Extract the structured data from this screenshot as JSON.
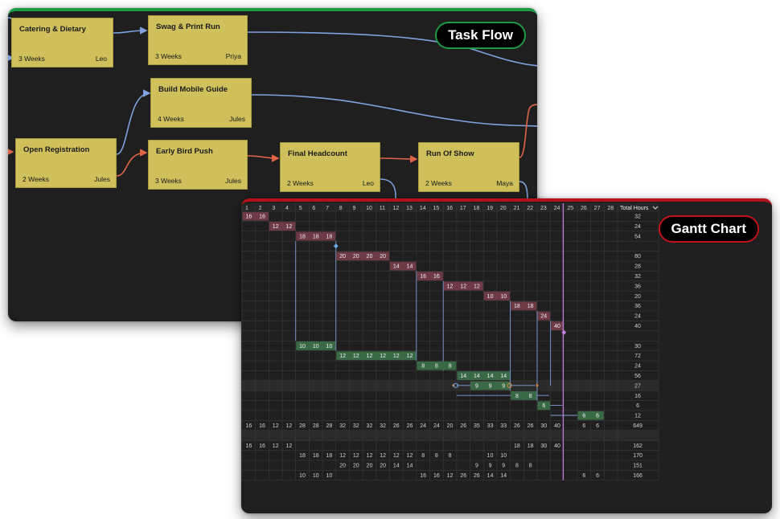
{
  "task_flow": {
    "title": "Task Flow",
    "tasks": [
      {
        "name": "Catering & Dietary",
        "duration": "3 Weeks",
        "owner": "Leo"
      },
      {
        "name": "Swag & Print Run",
        "duration": "3 Weeks",
        "owner": "Priya"
      },
      {
        "name": "Build Mobile Guide",
        "duration": "4 Weeks",
        "owner": "Jules"
      },
      {
        "name": "Open Registration",
        "duration": "2 Weeks",
        "owner": "Jules"
      },
      {
        "name": "Early Bird Push",
        "duration": "3 Weeks",
        "owner": "Jules"
      },
      {
        "name": "Final Headcount",
        "duration": "2 Weeks",
        "owner": "Leo"
      },
      {
        "name": "Run Of Show",
        "duration": "2 Weeks",
        "owner": "Maya"
      }
    ]
  },
  "gantt": {
    "title": "Gantt Chart",
    "total_label": "Total Hours",
    "columns": [
      "1",
      "2",
      "3",
      "4",
      "5",
      "6",
      "7",
      "8",
      "9",
      "10",
      "11",
      "12",
      "13",
      "14",
      "15",
      "16",
      "17",
      "18",
      "19",
      "20",
      "21",
      "22",
      "23",
      "24",
      "25",
      "26",
      "27",
      "28"
    ],
    "colors": {
      "red_bar": "#6e3a45",
      "green_bar": "#3a6a45",
      "today_line": "#c57ee0",
      "link_line": "#7f9fd8",
      "handle": "#e0883a"
    },
    "today_column": "24",
    "rows": [
      {
        "start": 1,
        "values": [
          "16",
          "16"
        ],
        "color": "red",
        "total": "32"
      },
      {
        "start": 3,
        "values": [
          "12",
          "12"
        ],
        "color": "red",
        "total": "24"
      },
      {
        "start": 5,
        "values": [
          "18",
          "18",
          "18"
        ],
        "color": "red",
        "total": "54"
      },
      {
        "start": 0,
        "values": [],
        "color": "",
        "total": ""
      },
      {
        "start": 8,
        "values": [
          "20",
          "20",
          "20",
          "20"
        ],
        "color": "red",
        "total": "80"
      },
      {
        "start": 12,
        "values": [
          "14",
          "14"
        ],
        "color": "red",
        "total": "28"
      },
      {
        "start": 14,
        "values": [
          "16",
          "16"
        ],
        "color": "red",
        "total": "32"
      },
      {
        "start": 16,
        "values": [
          "12",
          "12",
          "12"
        ],
        "color": "red",
        "total": "36"
      },
      {
        "start": 19,
        "values": [
          "10",
          "10"
        ],
        "color": "red",
        "total": "20"
      },
      {
        "start": 21,
        "values": [
          "18",
          "18"
        ],
        "color": "red",
        "total": "36"
      },
      {
        "start": 23,
        "values": [
          "24"
        ],
        "color": "red",
        "total": "24"
      },
      {
        "start": 24,
        "values": [
          "40"
        ],
        "color": "red",
        "total": "40"
      },
      {
        "start": 0,
        "values": [],
        "color": "",
        "total": ""
      },
      {
        "start": 5,
        "values": [
          "10",
          "10",
          "10"
        ],
        "color": "green",
        "total": "30"
      },
      {
        "start": 8,
        "values": [
          "12",
          "12",
          "12",
          "12",
          "12",
          "12"
        ],
        "color": "green",
        "total": "72"
      },
      {
        "start": 14,
        "values": [
          "8",
          "8",
          "8"
        ],
        "color": "green",
        "total": "24"
      },
      {
        "start": 17,
        "values": [
          "14",
          "14",
          "14",
          "14"
        ],
        "color": "green",
        "total": "56"
      },
      {
        "start": 18,
        "values": [
          "9",
          "9",
          "9"
        ],
        "color": "green",
        "total": "27"
      },
      {
        "start": 21,
        "values": [
          "8",
          "8"
        ],
        "color": "green",
        "total": "16"
      },
      {
        "start": 23,
        "values": [
          "6"
        ],
        "color": "green",
        "total": "6"
      },
      {
        "start": 26,
        "values": [
          "6",
          "6"
        ],
        "color": "green",
        "total": "12"
      }
    ],
    "summary_total": [
      "16",
      "16",
      "12",
      "12",
      "28",
      "28",
      "28",
      "32",
      "32",
      "32",
      "32",
      "26",
      "26",
      "24",
      "24",
      "20",
      "26",
      "35",
      "33",
      "33",
      "26",
      "26",
      "30",
      "40",
      "",
      "6",
      "6",
      ""
    ],
    "summary_total_hours": "649",
    "resources": [
      {
        "values": [
          "16",
          "16",
          "12",
          "12",
          "",
          "",
          "",
          "",
          "",
          "",
          "",
          "",
          "",
          "",
          "",
          "",
          "",
          "",
          "",
          "",
          "18",
          "18",
          "30",
          "40",
          "",
          "",
          "",
          ""
        ],
        "total": "162"
      },
      {
        "values": [
          "",
          "",
          "",
          "",
          "18",
          "18",
          "18",
          "12",
          "12",
          "12",
          "12",
          "12",
          "12",
          "8",
          "8",
          "8",
          "",
          "",
          "10",
          "10",
          "",
          "",
          "",
          "",
          "",
          "",
          "",
          ""
        ],
        "total": "170"
      },
      {
        "values": [
          "",
          "",
          "",
          "",
          "",
          "",
          "",
          "20",
          "20",
          "20",
          "20",
          "14",
          "14",
          "",
          "",
          "",
          "",
          "9",
          "9",
          "9",
          "8",
          "8",
          "",
          "",
          "",
          "",
          "",
          ""
        ],
        "total": "151"
      },
      {
        "values": [
          "",
          "",
          "",
          "",
          "10",
          "10",
          "10",
          "",
          "",
          "",
          "",
          "",
          "",
          "16",
          "16",
          "12",
          "26",
          "26",
          "14",
          "14",
          "",
          "",
          "",
          "",
          "",
          "6",
          "6",
          ""
        ],
        "total": "166"
      }
    ]
  }
}
